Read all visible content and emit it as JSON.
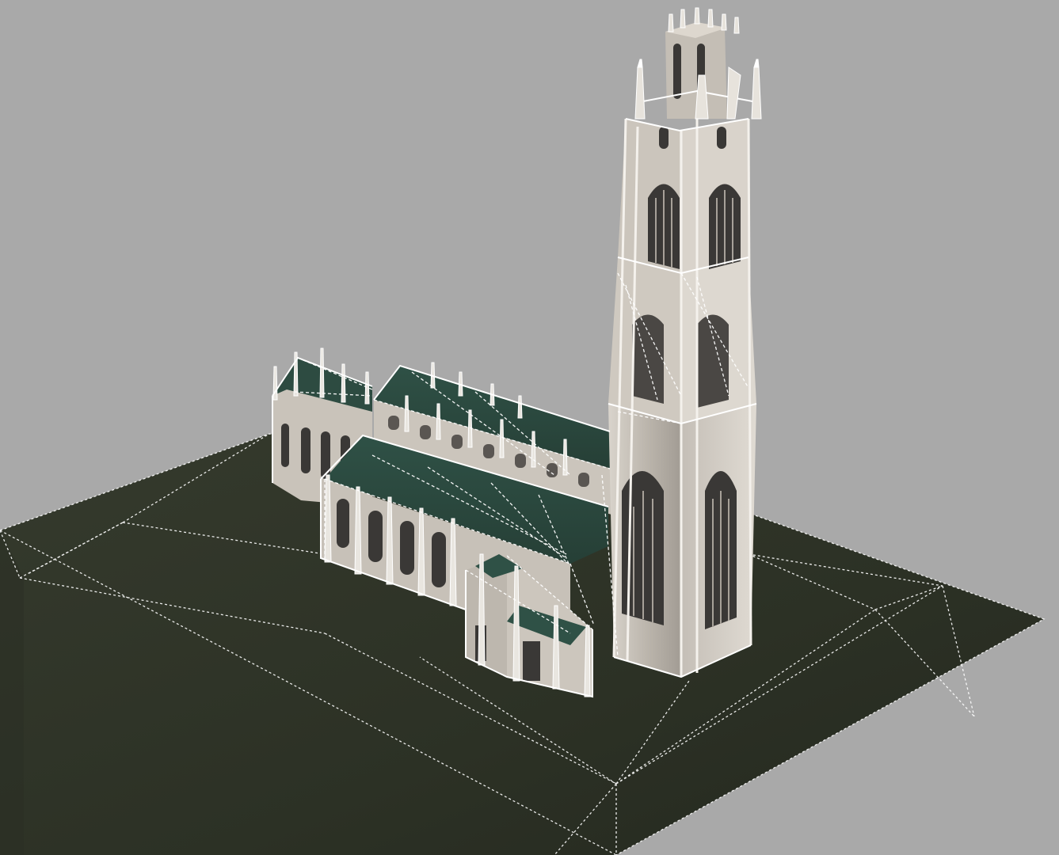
{
  "scene": {
    "subject": "church-tower-3d-model",
    "view": "perspective",
    "wireframe_overlay": true
  },
  "colors": {
    "background": "#a9a9a9",
    "ground": "#2f3428",
    "ground_dark": "#262a20",
    "roof": "#2c4a40",
    "roof_light": "#355a4e",
    "stone": "#cfcac2",
    "stone_dark": "#8f8a82",
    "window": "#3a3836",
    "wire": "#ffffff"
  }
}
